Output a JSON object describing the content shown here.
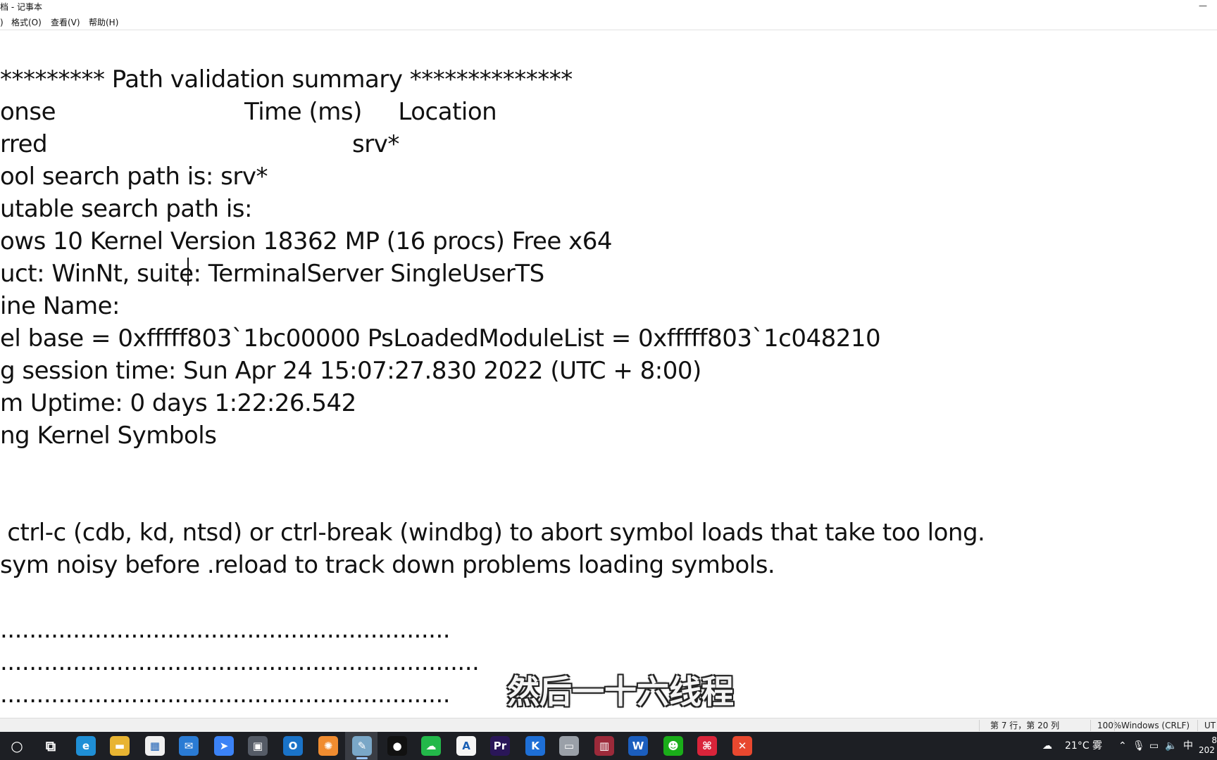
{
  "window": {
    "title": "档 - 记事本",
    "minimize_glyph": "—"
  },
  "menu": {
    "items": [
      {
        "label": ")"
      },
      {
        "label": "格式(O)"
      },
      {
        "label": "查看(V)"
      },
      {
        "label": "帮助(H)"
      }
    ]
  },
  "editor": {
    "lines": [
      "********* Path validation summary **************",
      "onse                          Time (ms)     Location",
      "rred                                          srv*",
      "ool search path is: srv*",
      "utable search path is:",
      "ows 10 Kernel Version 18362 MP (16 procs) Free x64",
      "uct: WinNt, suite: TerminalServer SingleUserTS",
      "ine Name:",
      "el base = 0xfffff803`1bc00000 PsLoadedModuleList = 0xfffff803`1c048210",
      "g session time: Sun Apr 24 15:07:27.830 2022 (UTC + 8:00)",
      "m Uptime: 0 days 1:22:26.542",
      "ng Kernel Symbols",
      "",
      "",
      " ctrl-c (cdb, kd, ntsd) or ctrl-break (windbg) to abort symbol loads that take too long.",
      "sym noisy before .reload to track down problems loading symbols.",
      "",
      "..............................................................",
      "..................................................................",
      ".............................................................."
    ]
  },
  "subtitle": "然后一十六线程",
  "statusbar": {
    "position": "第 7 行，第 20 列",
    "zoom": "100%",
    "line_ending": "Windows (CRLF)",
    "encoding": "UT"
  },
  "taskbar": {
    "apps": [
      {
        "name": "search-icon",
        "glyph": "○",
        "color": "transparent"
      },
      {
        "name": "task-view-icon",
        "glyph": "⧉",
        "color": "transparent"
      },
      {
        "name": "edge-icon",
        "glyph": "e",
        "color": "#1f8fd6"
      },
      {
        "name": "file-explorer-icon",
        "glyph": "▬",
        "color": "#e8b432"
      },
      {
        "name": "store-icon",
        "glyph": "▦",
        "color": "#f0f0f0"
      },
      {
        "name": "mail-icon",
        "glyph": "✉",
        "color": "#2a7bd4"
      },
      {
        "name": "feishu-icon",
        "glyph": "➤",
        "color": "#3b82f6"
      },
      {
        "name": "screen-tool-icon",
        "glyph": "▣",
        "color": "#555b66"
      },
      {
        "name": "outlook-icon",
        "glyph": "O",
        "color": "#1a73c8"
      },
      {
        "name": "settings-app-icon",
        "glyph": "✺",
        "color": "#f08c30"
      },
      {
        "name": "notepad-icon",
        "glyph": "✎",
        "color": "#7aa7c7"
      },
      {
        "name": "record-icon",
        "glyph": "●",
        "color": "#111"
      },
      {
        "name": "cloud-app-icon",
        "glyph": "☁",
        "color": "#23b84a"
      },
      {
        "name": "a-app-icon",
        "glyph": "A",
        "color": "#f5f5f5"
      },
      {
        "name": "premiere-icon",
        "glyph": "Pr",
        "color": "#2a1658"
      },
      {
        "name": "k-app-icon",
        "glyph": "K",
        "color": "#1e6fd6"
      },
      {
        "name": "drive-icon",
        "glyph": "▭",
        "color": "#9aa0a8"
      },
      {
        "name": "archive-icon",
        "glyph": "▥",
        "color": "#9c2a3a"
      },
      {
        "name": "word-app-icon",
        "glyph": "W",
        "color": "#1b5ebe"
      },
      {
        "name": "wechat-icon",
        "glyph": "☻",
        "color": "#1aad19"
      },
      {
        "name": "pdf-app-icon",
        "glyph": "⌘",
        "color": "#d9243a"
      },
      {
        "name": "x-app-icon",
        "glyph": "✕",
        "color": "#e8482f"
      }
    ],
    "tray": {
      "weather": "21°C 雾",
      "ime": "中",
      "clock_top": "8",
      "clock_bottom": "202"
    }
  }
}
